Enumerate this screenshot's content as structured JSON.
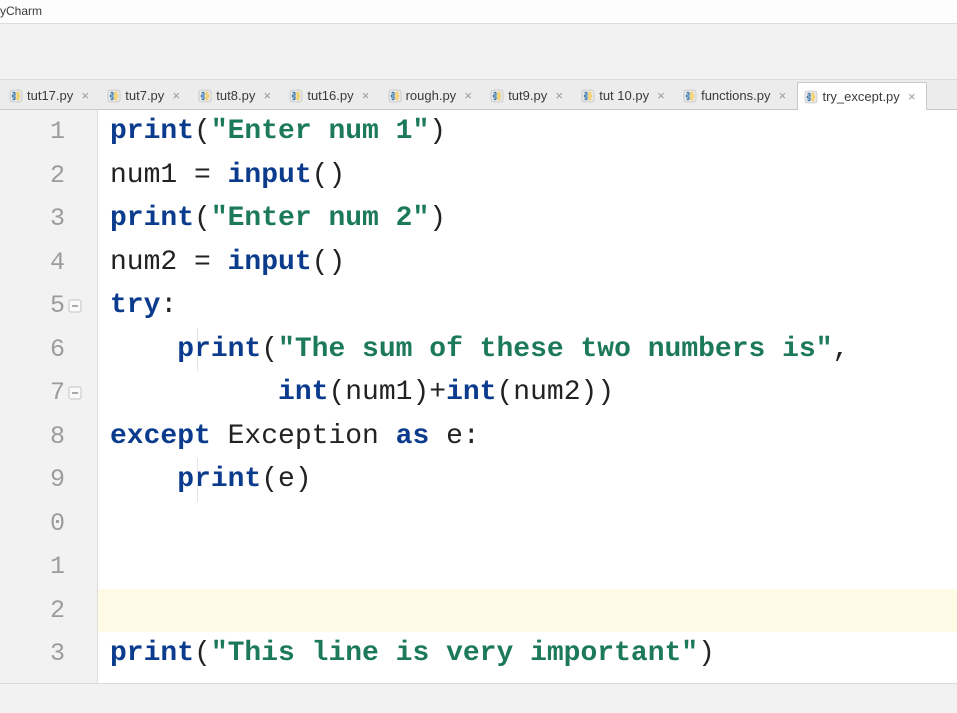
{
  "app": {
    "title": "yCharm"
  },
  "tabs": [
    {
      "label": "tut17.py",
      "active": false
    },
    {
      "label": "tut7.py",
      "active": false
    },
    {
      "label": "tut8.py",
      "active": false
    },
    {
      "label": "tut16.py",
      "active": false
    },
    {
      "label": "rough.py",
      "active": false
    },
    {
      "label": "tut9.py",
      "active": false
    },
    {
      "label": "tut 10.py",
      "active": false
    },
    {
      "label": "functions.py",
      "active": false
    },
    {
      "label": "try_except.py",
      "active": true
    }
  ],
  "editor": {
    "current_line_index": 11,
    "lines": [
      {
        "n": "1",
        "indent": 0,
        "tokens": [
          {
            "t": "builtin",
            "v": "print"
          },
          {
            "t": "punc",
            "v": "("
          },
          {
            "t": "str",
            "v": "\"Enter num 1\""
          },
          {
            "t": "punc",
            "v": ")"
          }
        ]
      },
      {
        "n": "2",
        "indent": 0,
        "tokens": [
          {
            "t": "name",
            "v": "num1 "
          },
          {
            "t": "punc",
            "v": "= "
          },
          {
            "t": "builtin",
            "v": "input"
          },
          {
            "t": "punc",
            "v": "()"
          }
        ]
      },
      {
        "n": "3",
        "indent": 0,
        "tokens": [
          {
            "t": "builtin",
            "v": "print"
          },
          {
            "t": "punc",
            "v": "("
          },
          {
            "t": "str",
            "v": "\"Enter num 2\""
          },
          {
            "t": "punc",
            "v": ")"
          }
        ]
      },
      {
        "n": "4",
        "indent": 0,
        "tokens": [
          {
            "t": "name",
            "v": "num2 "
          },
          {
            "t": "punc",
            "v": "= "
          },
          {
            "t": "builtin",
            "v": "input"
          },
          {
            "t": "punc",
            "v": "()"
          }
        ]
      },
      {
        "n": "5",
        "indent": 0,
        "fold": true,
        "tokens": [
          {
            "t": "kw",
            "v": "try"
          },
          {
            "t": "punc",
            "v": ":"
          }
        ]
      },
      {
        "n": "6",
        "indent": 1,
        "tokens": [
          {
            "t": "builtin",
            "v": "print"
          },
          {
            "t": "punc",
            "v": "("
          },
          {
            "t": "str",
            "v": "\"The sum of these two numbers is\""
          },
          {
            "t": "punc",
            "v": ","
          }
        ]
      },
      {
        "n": "7",
        "indent": 0,
        "fold": true,
        "tokens": [
          {
            "t": "punc",
            "v": "          "
          },
          {
            "t": "builtin",
            "v": "int"
          },
          {
            "t": "punc",
            "v": "(num1)+"
          },
          {
            "t": "builtin",
            "v": "int"
          },
          {
            "t": "punc",
            "v": "(num2))"
          }
        ]
      },
      {
        "n": "8",
        "indent": 0,
        "tokens": [
          {
            "t": "kw",
            "v": "except "
          },
          {
            "t": "cls",
            "v": "Exception "
          },
          {
            "t": "kw",
            "v": "as "
          },
          {
            "t": "name",
            "v": "e"
          },
          {
            "t": "punc",
            "v": ":"
          }
        ]
      },
      {
        "n": "9",
        "indent": 1,
        "tokens": [
          {
            "t": "builtin",
            "v": "print"
          },
          {
            "t": "punc",
            "v": "(e)"
          }
        ]
      },
      {
        "n": "0",
        "indent": 0,
        "tokens": []
      },
      {
        "n": "1",
        "indent": 0,
        "tokens": []
      },
      {
        "n": "2",
        "indent": 0,
        "tokens": []
      },
      {
        "n": "3",
        "indent": 0,
        "tokens": [
          {
            "t": "builtin",
            "v": "print"
          },
          {
            "t": "punc",
            "v": "("
          },
          {
            "t": "str",
            "v": "\"This line is very important\""
          },
          {
            "t": "punc",
            "v": ")"
          }
        ]
      }
    ]
  }
}
